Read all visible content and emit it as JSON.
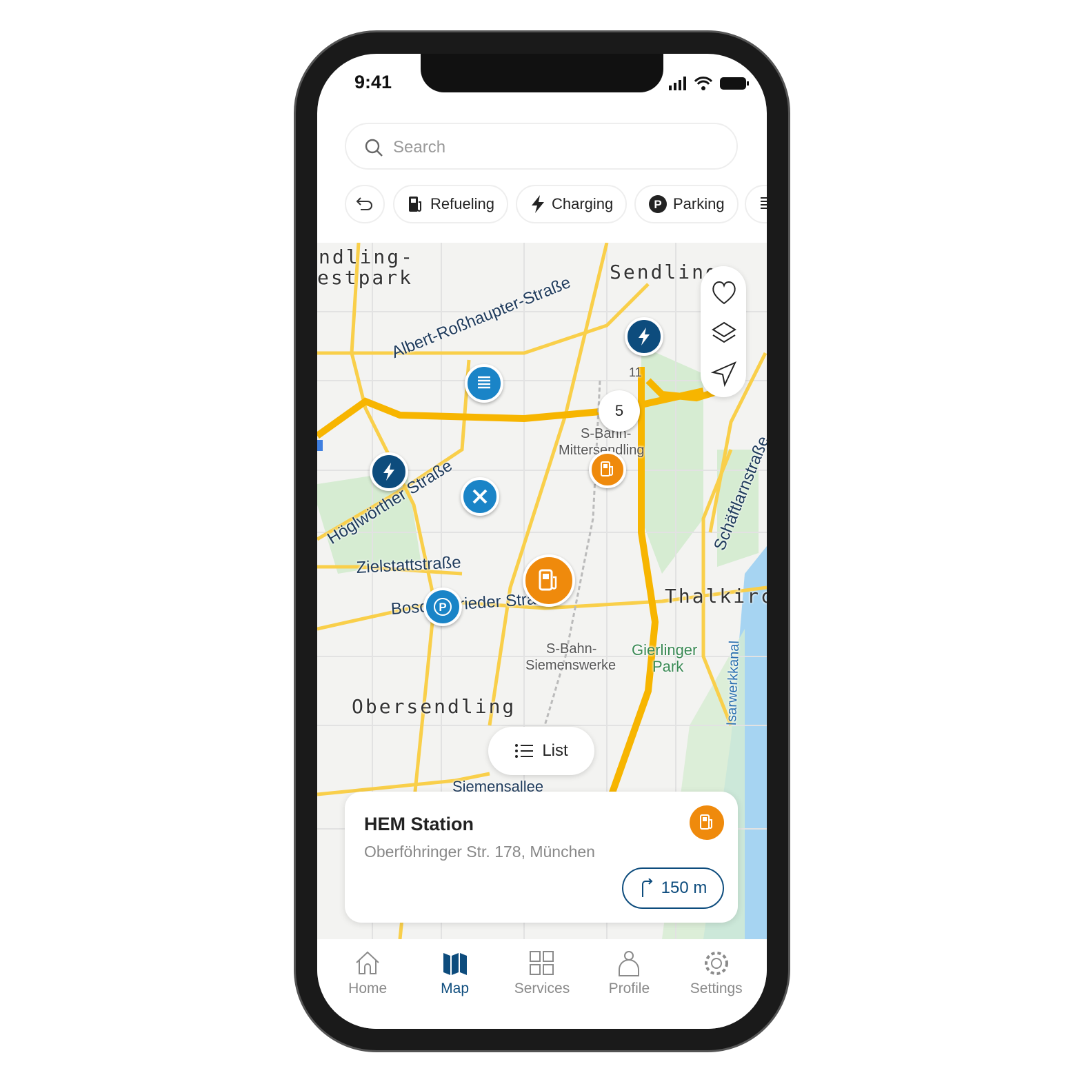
{
  "status": {
    "time": "9:41"
  },
  "search": {
    "placeholder": "Search"
  },
  "filters": [
    {
      "label": "Refueling",
      "icon": "fuel-icon"
    },
    {
      "label": "Charging",
      "icon": "bolt-icon"
    },
    {
      "label": "Parking",
      "icon": "parking-icon"
    }
  ],
  "map": {
    "labels": [
      "ndling-",
      "estpark",
      "Sendling",
      "Albert-Roßhaupter-Straße",
      "S-Bahn-",
      "Mittersendling",
      "Höglwörther Straße",
      "Zielstattstraße",
      "Boschetsrieder Straße",
      "S-Bahn-",
      "Siemenswerke",
      "Gierlinger",
      "Park",
      "Obersendling",
      "Thalkirchen",
      "Schäftlarnstraße",
      "Isarwerkkanal",
      "Siemensallee",
      "11"
    ],
    "cluster_count": "5",
    "colors": {
      "road": "#f9cf4a",
      "fuel": "#ef8a0c",
      "charging": "#0d4c7d",
      "service": "#1a84c7",
      "park": "#d6ecd2",
      "water": "#a6d4f2"
    }
  },
  "list_button": "List",
  "card": {
    "title": "HEM Station",
    "address": "Oberföhringer Str. 178, München",
    "distance": "150 m"
  },
  "nav": [
    {
      "label": "Home",
      "icon": "home-icon"
    },
    {
      "label": "Map",
      "icon": "map-icon",
      "active": true
    },
    {
      "label": "Services",
      "icon": "grid-icon"
    },
    {
      "label": "Profile",
      "icon": "person-icon"
    },
    {
      "label": "Settings",
      "icon": "gear-icon"
    }
  ]
}
